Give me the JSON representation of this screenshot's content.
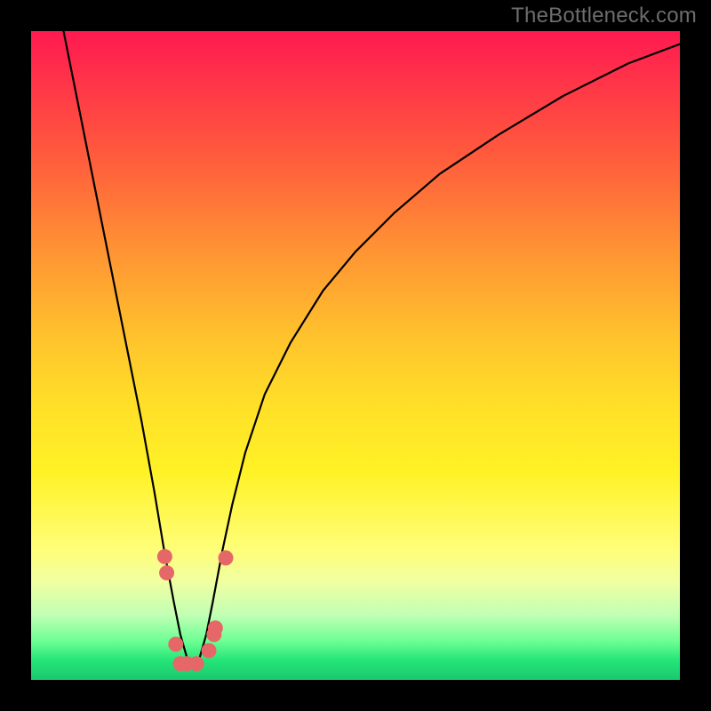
{
  "watermark": "TheBottleneck.com",
  "colors": {
    "curve": "#000000",
    "marker_fill": "#e66767",
    "marker_stroke": "#c94a4a"
  },
  "chart_data": {
    "type": "line",
    "title": "",
    "xlabel": "",
    "ylabel": "",
    "x_range": [
      0,
      100
    ],
    "y_range": [
      0,
      100
    ],
    "optimum_x": 25,
    "curve": {
      "x": [
        5,
        7,
        9,
        11,
        13,
        15,
        17,
        19,
        20.5,
        22,
        23,
        24,
        25,
        26,
        27,
        28,
        29.5,
        31,
        33,
        36,
        40,
        45,
        50,
        56,
        63,
        72,
        82,
        92,
        100
      ],
      "y": [
        100,
        90,
        80,
        70,
        60,
        50,
        40,
        29,
        20,
        12,
        7,
        3.5,
        2.5,
        3.5,
        7,
        12,
        20,
        27,
        35,
        44,
        52,
        60,
        66,
        72,
        78,
        84,
        90,
        95,
        98
      ]
    },
    "markers": [
      {
        "x": 20.6,
        "y": 19
      },
      {
        "x": 20.9,
        "y": 16.5
      },
      {
        "x": 22.3,
        "y": 5.5
      },
      {
        "x": 23.0,
        "y": 2.5
      },
      {
        "x": 24.0,
        "y": 2.5
      },
      {
        "x": 25.5,
        "y": 2.5
      },
      {
        "x": 27.4,
        "y": 4.5
      },
      {
        "x": 28.2,
        "y": 7.0
      },
      {
        "x": 28.4,
        "y": 8.0
      },
      {
        "x": 30.0,
        "y": 18.8
      }
    ]
  }
}
